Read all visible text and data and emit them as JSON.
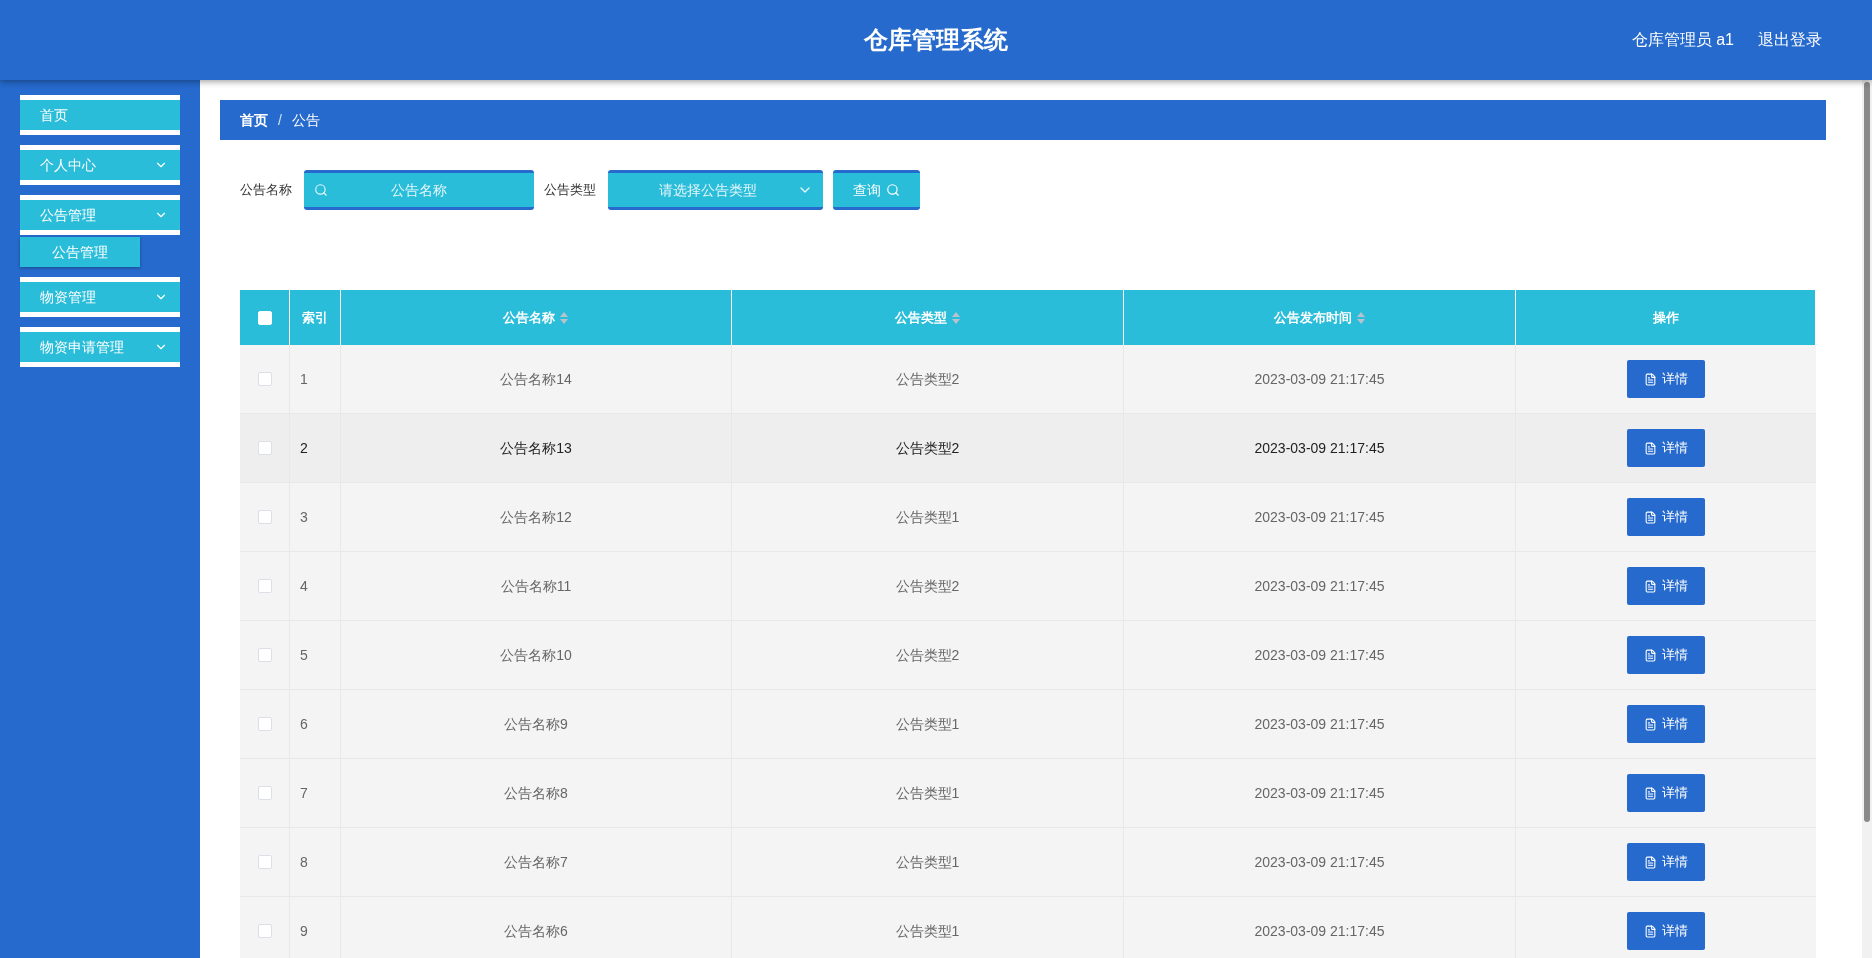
{
  "header": {
    "title": "仓库管理系统",
    "user": "仓库管理员 a1",
    "logout": "退出登录"
  },
  "sidebar": {
    "items": [
      {
        "label": "首页",
        "has_children": false
      },
      {
        "label": "个人中心",
        "has_children": true
      },
      {
        "label": "公告管理",
        "has_children": true,
        "children": [
          {
            "label": "公告管理"
          }
        ]
      },
      {
        "label": "物资管理",
        "has_children": true
      },
      {
        "label": "物资申请管理",
        "has_children": true
      }
    ]
  },
  "breadcrumb": {
    "separator": "/",
    "items": [
      "首页",
      "公告"
    ]
  },
  "search": {
    "name_label": "公告名称",
    "name_placeholder": "公告名称",
    "type_label": "公告类型",
    "type_placeholder": "请选择公告类型",
    "button": "查询"
  },
  "table": {
    "columns": [
      {
        "label": "索引",
        "sortable": false
      },
      {
        "label": "公告名称",
        "sortable": true
      },
      {
        "label": "公告类型",
        "sortable": true
      },
      {
        "label": "公告发布时间",
        "sortable": true
      },
      {
        "label": "操作",
        "sortable": false
      }
    ],
    "all_checked": false,
    "rows": [
      {
        "index": "1",
        "name": "公告名称14",
        "type": "公告类型2",
        "time": "2023-03-09 21:17:45",
        "action": "详情",
        "checked": false,
        "hovered": false
      },
      {
        "index": "2",
        "name": "公告名称13",
        "type": "公告类型2",
        "time": "2023-03-09 21:17:45",
        "action": "详情",
        "checked": false,
        "hovered": true
      },
      {
        "index": "3",
        "name": "公告名称12",
        "type": "公告类型1",
        "time": "2023-03-09 21:17:45",
        "action": "详情",
        "checked": false,
        "hovered": false
      },
      {
        "index": "4",
        "name": "公告名称11",
        "type": "公告类型2",
        "time": "2023-03-09 21:17:45",
        "action": "详情",
        "checked": false,
        "hovered": false
      },
      {
        "index": "5",
        "name": "公告名称10",
        "type": "公告类型2",
        "time": "2023-03-09 21:17:45",
        "action": "详情",
        "checked": false,
        "hovered": false
      },
      {
        "index": "6",
        "name": "公告名称9",
        "type": "公告类型1",
        "time": "2023-03-09 21:17:45",
        "action": "详情",
        "checked": false,
        "hovered": false
      },
      {
        "index": "7",
        "name": "公告名称8",
        "type": "公告类型1",
        "time": "2023-03-09 21:17:45",
        "action": "详情",
        "checked": false,
        "hovered": false
      },
      {
        "index": "8",
        "name": "公告名称7",
        "type": "公告类型1",
        "time": "2023-03-09 21:17:45",
        "action": "详情",
        "checked": false,
        "hovered": false
      },
      {
        "index": "9",
        "name": "公告名称6",
        "type": "公告类型1",
        "time": "2023-03-09 21:17:45",
        "action": "详情",
        "checked": false,
        "hovered": false
      }
    ]
  }
}
